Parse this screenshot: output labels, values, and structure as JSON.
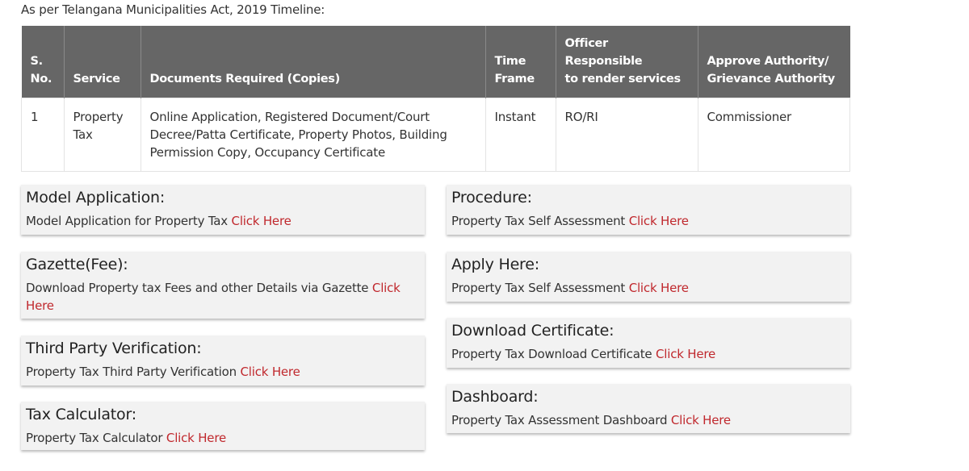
{
  "intro": "As per Telangana Municipalities Act, 2019 Timeline:",
  "table": {
    "headers": {
      "sno_line1": "S.",
      "sno_line2": "No.",
      "service": "Service",
      "documents": "Documents Required (Copies)",
      "time_line1": "Time",
      "time_line2": "Frame",
      "officer_line1": "Officer Responsible",
      "officer_line2": "to render services",
      "authority_line1": "Approve Authority/",
      "authority_line2": "Grievance Authority"
    },
    "rows": [
      {
        "sno": "1",
        "service": "Property Tax",
        "documents": "Online Application, Registered Document/Court Decree/Patta Certificate, Property Photos, Building Permission Copy, Occupancy Certificate",
        "time_frame": "Instant",
        "officer": "RO/RI",
        "authority": "Commissioner"
      }
    ]
  },
  "link_color": "#c0282d",
  "cards": {
    "model_application": {
      "title": "Model Application:",
      "text": "Model Application for Property Tax",
      "link": "Click Here"
    },
    "gazette": {
      "title": "Gazette(Fee):",
      "text": "Download Property tax Fees and other Details via Gazette",
      "link": "Click Here"
    },
    "third_party": {
      "title": "Third Party Verification:",
      "text": "Property Tax Third Party Verification",
      "link": "Click Here"
    },
    "tax_calculator": {
      "title": "Tax Calculator:",
      "text": "Property Tax Calculator",
      "link": "Click Here"
    },
    "procedure": {
      "title": "Procedure:",
      "text": "Property Tax Self Assessment",
      "link": "Click Here"
    },
    "apply_here": {
      "title": "Apply Here:",
      "text": "Property Tax Self Assessment",
      "link": "Click Here"
    },
    "download_certificate": {
      "title": "Download Certificate:",
      "text": "Property Tax Download Certificate",
      "link": "Click Here"
    },
    "dashboard": {
      "title": "Dashboard:",
      "text": "Property Tax Assessment Dashboard",
      "link": "Click Here"
    }
  }
}
